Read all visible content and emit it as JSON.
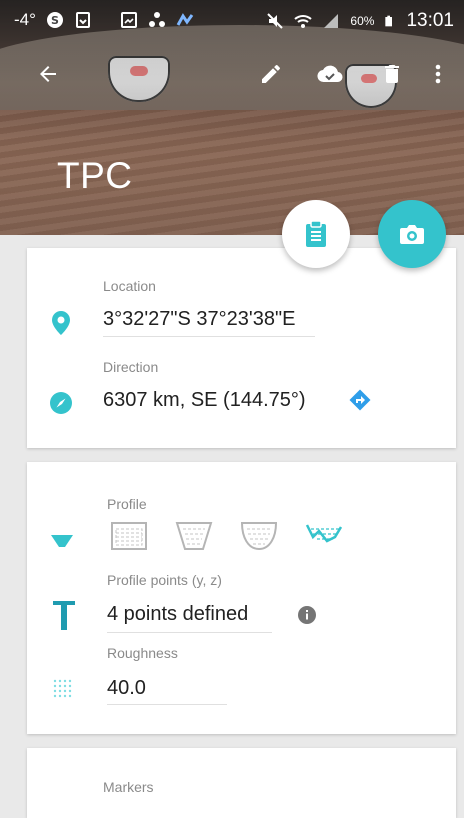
{
  "status_bar": {
    "temperature": "-4°",
    "battery_percent": "60%",
    "time": "13:01"
  },
  "toolbar": {
    "back": "arrow-back-icon",
    "edit": "pencil-icon",
    "sync": "cloud-done-icon",
    "delete": "trash-icon",
    "more": "more-vert-icon"
  },
  "title": "TPC",
  "colors": {
    "accent": "#34c3cc",
    "text_primary": "#212121",
    "text_secondary": "#8a8a8a",
    "background": "#e9e9e9"
  },
  "location_card": {
    "location_label": "Location",
    "location_value": "3°32'27\"S 37°23'38\"E",
    "direction_label": "Direction",
    "direction_value": "6307 km, SE (144.75°)"
  },
  "profile_card": {
    "profile_label": "Profile",
    "profile_options": [
      "rectangular",
      "trapezoidal",
      "parabolic",
      "custom"
    ],
    "selected_profile": "custom",
    "profile_points_label": "Profile points (y, z)",
    "profile_points_value": "4 points defined",
    "roughness_label": "Roughness",
    "roughness_value": "40.0"
  },
  "markers_card": {
    "markers_label": "Markers"
  }
}
